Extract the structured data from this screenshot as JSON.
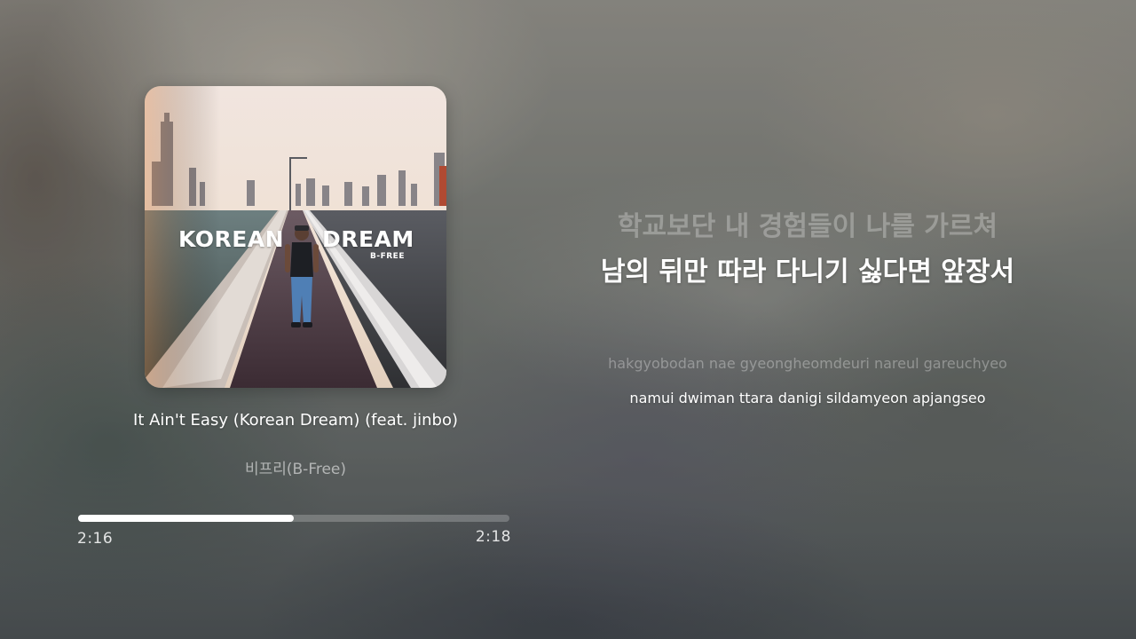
{
  "album": {
    "cover_title_word_1": "KOREAN",
    "cover_title_word_2": "DREAM",
    "cover_artist_tag": "B-FREE"
  },
  "track": {
    "title": "It Ain't Easy (Korean Dream) (feat. jinbo)",
    "artist": "비프리(B-Free)"
  },
  "playback": {
    "elapsed": "2:16",
    "total": "2:18",
    "progress_fraction": 0.5
  },
  "lyrics": {
    "previous_korean": "학교보단 내 경험들이 나를 가르쳐",
    "current_korean": "남의 뒤만 따라 다니기 싫다면 앞장서",
    "previous_romanized": "hakgyobodan nae gyeongheomdeuri nareul gareuchyeo",
    "current_romanized": "namui dwiman ttara danigi sildamyeon apjangseo"
  },
  "colors": {
    "progress_fill": "#ffffff",
    "progress_track": "rgba(255,255,255,0.22)",
    "active_lyric": "#ffffff"
  }
}
